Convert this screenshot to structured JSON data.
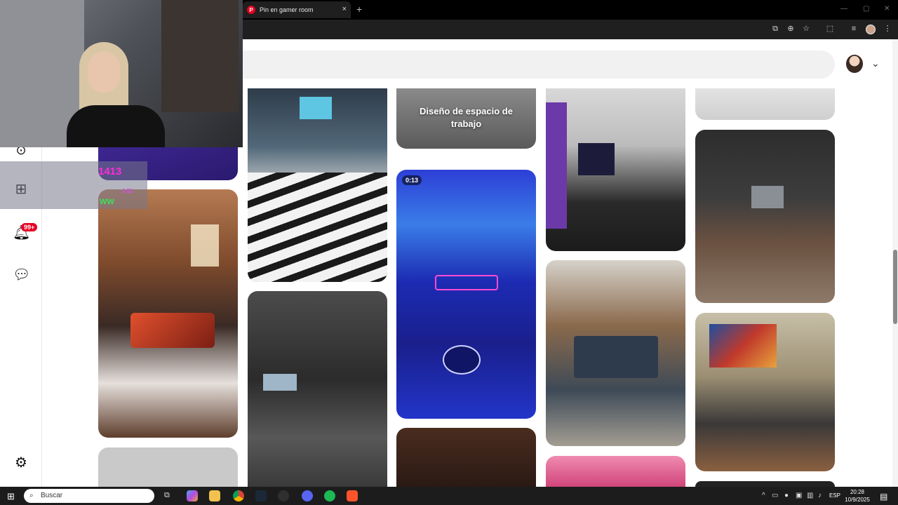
{
  "browser": {
    "tab_title": "Pin en gamer room",
    "new_tab": "+",
    "close": "×"
  },
  "sidebar": {
    "notifications_badge": "99+"
  },
  "pins": [
    {
      "overlay_text": "Diseño de espacio de trabajo"
    },
    {
      "duration": "0:13"
    }
  ],
  "stream_overlay": {
    "count": "1413",
    "value": "0.52",
    "ww": "WW"
  },
  "taskbar": {
    "search_placeholder": "Buscar",
    "lang": "ESP",
    "time": "20:28",
    "date": "10/9/2025"
  }
}
